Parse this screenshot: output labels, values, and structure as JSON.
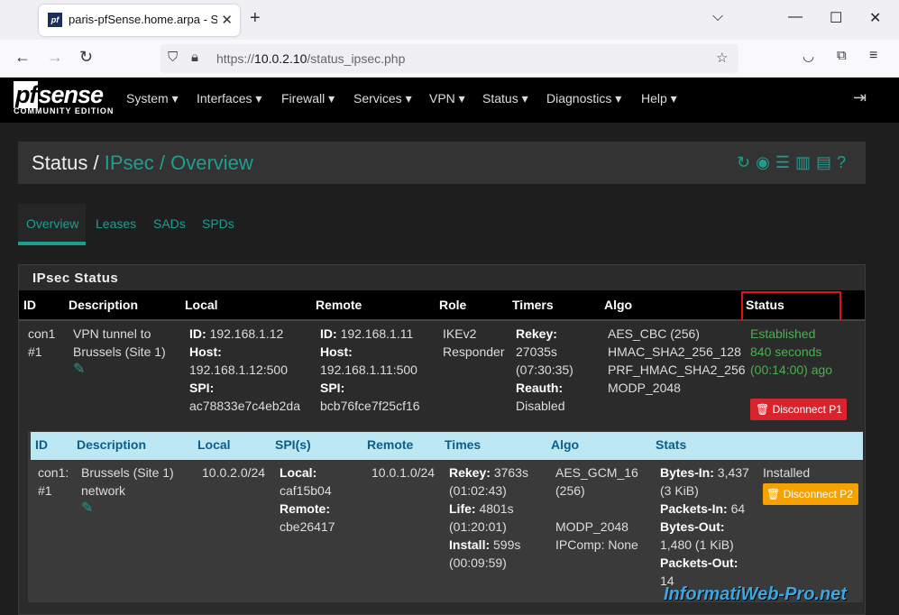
{
  "browser": {
    "tab_title": "paris-pfSense.home.arpa - Status",
    "url_prefix": "https://",
    "url_host": "10.0.2.10",
    "url_path": "/status_ipsec.php"
  },
  "pfsense": {
    "logo_main": "sense",
    "logo_pf": "pf",
    "logo_sub": "COMMUNITY EDITION",
    "menu": [
      "System ▾",
      "Interfaces ▾",
      "Firewall ▾",
      "Services ▾",
      "VPN ▾",
      "Status ▾",
      "Diagnostics ▾",
      "Help ▾"
    ]
  },
  "breadcrumb": {
    "root": "Status /",
    "level1": "IPsec /",
    "level2": "Overview"
  },
  "tabs": [
    "Overview",
    "Leases",
    "SADs",
    "SPDs"
  ],
  "panel": {
    "title": "IPsec Status",
    "headers": [
      "ID",
      "Description",
      "Local",
      "Remote",
      "Role",
      "Timers",
      "Algo",
      "Status"
    ],
    "p1": {
      "id": [
        "con1",
        "#1"
      ],
      "description": [
        "VPN tunnel to",
        "Brussels (Site 1)"
      ],
      "local": {
        "id_label": "ID:",
        "id": "192.168.1.12",
        "host_label": "Host:",
        "host": "192.168.1.12:500",
        "spi_label": "SPI:",
        "spi": "ac78833e7c4eb2da"
      },
      "remote": {
        "id_label": "ID:",
        "id": "192.168.1.11",
        "host_label": "Host:",
        "host": "192.168.1.11:500",
        "spi_label": "SPI:",
        "spi": "bcb76fce7f25cf16"
      },
      "role": [
        "IKEv2",
        "Responder"
      ],
      "timers": {
        "rekey_label": "Rekey:",
        "rekey": "27035s",
        "rekey_time": "(07:30:35)",
        "reauth_label": "Reauth:",
        "reauth": "Disabled"
      },
      "algo": [
        "AES_CBC (256)",
        "HMAC_SHA2_256_128",
        "PRF_HMAC_SHA2_256",
        "MODP_2048"
      ],
      "status": [
        "Established",
        "840 seconds",
        "(00:14:00) ago"
      ],
      "disconnect": "Disconnect P1"
    },
    "p2": {
      "headers": [
        "ID",
        "Description",
        "Local",
        "SPI(s)",
        "Remote",
        "Times",
        "Algo",
        "Stats"
      ],
      "id": [
        "con1:",
        "#1"
      ],
      "description": [
        "Brussels (Site 1)",
        "network"
      ],
      "local": "10.0.2.0/24",
      "spi": {
        "local_label": "Local:",
        "local": "caf15b04",
        "remote_label": "Remote:",
        "remote": "cbe26417"
      },
      "remote": "10.0.1.0/24",
      "times": {
        "rekey_label": "Rekey:",
        "rekey": "3763s",
        "rekey_time": "(01:02:43)",
        "life_label": "Life:",
        "life": "4801s",
        "life_time": "(01:20:01)",
        "install_label": "Install:",
        "install": "599s",
        "install_time": "(00:09:59)"
      },
      "algo": [
        "AES_GCM_16",
        "(256)",
        "MODP_2048",
        "IPComp: None"
      ],
      "stats": {
        "bytes_in_label": "Bytes-In:",
        "bytes_in": "3,437",
        "bytes_in_kib": "(3 KiB)",
        "packets_in_label": "Packets-In:",
        "packets_in": "64",
        "bytes_out_label": "Bytes-Out:",
        "bytes_out": "1,480 (1 KiB)",
        "packets_out_label": "Packets-Out:",
        "packets_out": "14"
      },
      "status": "Installed",
      "disconnect": "Disconnect P2"
    }
  },
  "watermark": "InformatiWeb-Pro.net",
  "colors": {
    "accent": "#1f9e8f",
    "established": "#4caf50",
    "danger": "#d9232d",
    "warning": "#f5a200"
  }
}
